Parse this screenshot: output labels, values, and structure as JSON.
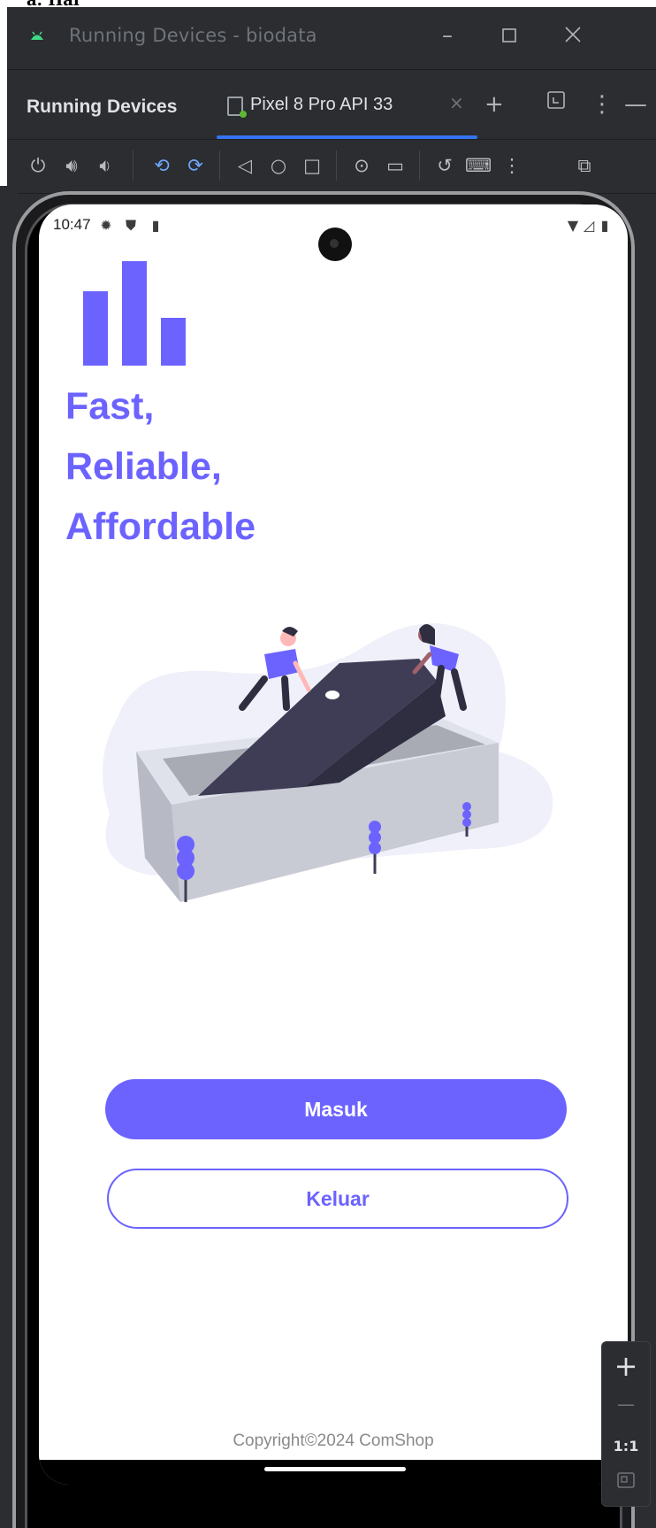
{
  "window": {
    "title": "Running Devices - biodata"
  },
  "panel": {
    "title": "Running Devices",
    "tab_label": "Pixel 8 Pro API 33",
    "tab_close": "×"
  },
  "phone": {
    "status_time": "10:47",
    "headline": [
      "Fast,",
      "Reliable,",
      "Affordable"
    ],
    "primary_button": "Masuk",
    "secondary_button": "Keluar",
    "copyright": "Copyright©2024 ComShop"
  },
  "zoom": {
    "plus": "+",
    "minus": "—",
    "actual": "1:1"
  },
  "colors": {
    "accent": "#6c63ff",
    "ide_bg": "#2b2d30",
    "tab_underline": "#3574f0"
  },
  "icons": {
    "titlebar": [
      "android-icon",
      "minimize-icon",
      "maximize-icon",
      "close-icon"
    ],
    "toolbar": [
      "power-icon",
      "volume-up-icon",
      "volume-down-icon",
      "rotate-left-icon",
      "rotate-right-icon",
      "back-icon",
      "home-icon",
      "overview-icon",
      "screenshot-icon",
      "screen-record-icon",
      "snapshot-icon",
      "keyboard-icon",
      "more-icon",
      "inspect-icon"
    ]
  }
}
